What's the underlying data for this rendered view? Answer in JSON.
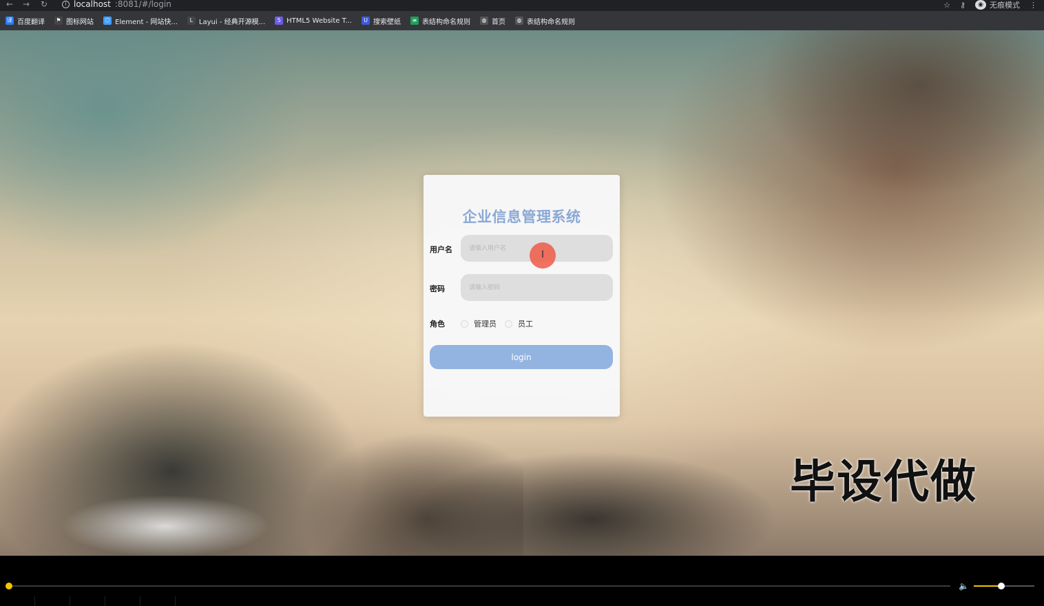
{
  "browser": {
    "url_host": "localhost",
    "url_path": ":8081/#/login",
    "incognito_label": "无痕模式",
    "bookmarks": [
      {
        "label": "百度翻译",
        "icon": "baidu-translate-icon",
        "color": "#2b7cf6"
      },
      {
        "label": "图标网站",
        "icon": "flag-icon",
        "color": "#444"
      },
      {
        "label": "Element - 网站快...",
        "icon": "element-icon",
        "color": "#409eff"
      },
      {
        "label": "Layui - 经典开源模...",
        "icon": "layui-icon",
        "color": "#444"
      },
      {
        "label": "HTML5 Website T...",
        "icon": "html5-icon",
        "color": "#6c5ce7"
      },
      {
        "label": "搜索壁纸",
        "icon": "wallpaper-icon",
        "color": "#3b5bdb"
      },
      {
        "label": "表结构命名规则",
        "icon": "table-icon",
        "color": "#1e9e5a"
      },
      {
        "label": "首页",
        "icon": "globe-icon",
        "color": "#555"
      },
      {
        "label": "表结构命名规则",
        "icon": "globe-icon",
        "color": "#555"
      }
    ]
  },
  "login": {
    "title": "企业信息管理系统",
    "username_label": "用户名",
    "username_placeholder": "请输入用户名",
    "password_label": "密码",
    "password_placeholder": "请输入密码",
    "role_label": "角色",
    "roles": [
      "管理员",
      "员工"
    ],
    "button_label": "login"
  },
  "watermark": "毕设代做",
  "player": {
    "volume_level": 0.45,
    "accent_color": "#f5c400"
  }
}
